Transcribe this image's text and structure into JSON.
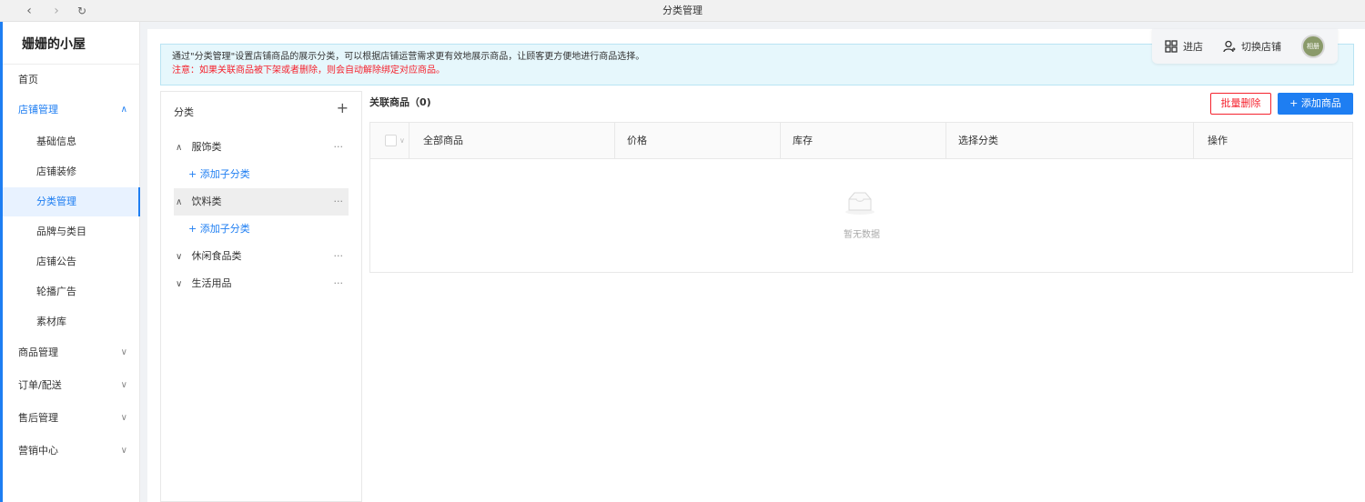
{
  "window": {
    "title": "分类管理"
  },
  "sidebar": {
    "shop_name": "姗姗的小屋",
    "items": [
      {
        "label": "首页",
        "chevron": ""
      },
      {
        "label": "店铺管理",
        "chevron": "^"
      },
      {
        "label": "基础信息"
      },
      {
        "label": "店铺装修"
      },
      {
        "label": "分类管理"
      },
      {
        "label": "品牌与类目"
      },
      {
        "label": "店铺公告"
      },
      {
        "label": "轮播广告"
      },
      {
        "label": "素材库"
      },
      {
        "label": "商品管理",
        "chevron": "v"
      },
      {
        "label": "订单/配送",
        "chevron": "v"
      },
      {
        "label": "售后管理",
        "chevron": "v"
      },
      {
        "label": "营销中心",
        "chevron": "v"
      }
    ]
  },
  "header": {
    "enter_store": "进店",
    "switch_store": "切换店铺",
    "avatar_text": "相册"
  },
  "notice": {
    "line1": "通过\"分类管理\"设置店铺商品的展示分类，可以根据店铺运营需求更有效地展示商品，让顾客更方便地进行商品选择。",
    "line2": "注意：如果关联商品被下架或者删除，则会自动解除绑定对应商品。"
  },
  "categories": {
    "header": "分类",
    "add_symbol": "+",
    "items": [
      {
        "label": "服饰类",
        "arrow": "∧",
        "more": "···"
      },
      {
        "label": "饮料类",
        "arrow": "∧",
        "more": "···"
      },
      {
        "label": "休闲食品类",
        "arrow": "∨",
        "more": "···"
      },
      {
        "label": "生活用品",
        "arrow": "∨",
        "more": "···"
      }
    ],
    "add_sub_label": "+ 添加子分类"
  },
  "products": {
    "title": "关联商品（0)",
    "batch_delete": "批量删除",
    "add_product": "+ 添加商品",
    "columns": [
      "全部商品",
      "价格",
      "库存",
      "选择分类",
      "操作"
    ],
    "empty_text": "暂无数据"
  }
}
